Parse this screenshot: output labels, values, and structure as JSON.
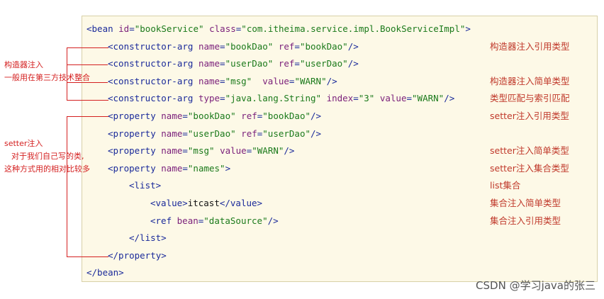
{
  "code_lines": [
    {
      "indent": 0,
      "parts": [
        [
          "tag",
          "<bean "
        ],
        [
          "attr",
          "id"
        ],
        [
          "tag",
          "="
        ],
        [
          "val",
          "\"bookService\""
        ],
        [
          "tag",
          " "
        ],
        [
          "attr",
          "class"
        ],
        [
          "tag",
          "="
        ],
        [
          "val",
          "\"com.itheima.service.impl.BookServiceImpl\""
        ],
        [
          "tag",
          ">"
        ]
      ]
    },
    {
      "indent": 1,
      "parts": [
        [
          "tag",
          "<constructor-arg "
        ],
        [
          "attr",
          "name"
        ],
        [
          "tag",
          "="
        ],
        [
          "val",
          "\"bookDao\""
        ],
        [
          "tag",
          " "
        ],
        [
          "attr",
          "ref"
        ],
        [
          "tag",
          "="
        ],
        [
          "val",
          "\"bookDao\""
        ],
        [
          "tag",
          "/>"
        ]
      ]
    },
    {
      "indent": 1,
      "parts": [
        [
          "tag",
          "<constructor-arg "
        ],
        [
          "attr",
          "name"
        ],
        [
          "tag",
          "="
        ],
        [
          "val",
          "\"userDao\""
        ],
        [
          "tag",
          " "
        ],
        [
          "attr",
          "ref"
        ],
        [
          "tag",
          "="
        ],
        [
          "val",
          "\"userDao\""
        ],
        [
          "tag",
          "/>"
        ]
      ]
    },
    {
      "indent": 1,
      "parts": [
        [
          "tag",
          "<constructor-arg "
        ],
        [
          "attr",
          "name"
        ],
        [
          "tag",
          "="
        ],
        [
          "val",
          "\"msg\""
        ],
        [
          "tag",
          "  "
        ],
        [
          "attr",
          "value"
        ],
        [
          "tag",
          "="
        ],
        [
          "val",
          "\"WARN\""
        ],
        [
          "tag",
          "/>"
        ]
      ]
    },
    {
      "indent": 1,
      "parts": [
        [
          "tag",
          "<constructor-arg "
        ],
        [
          "attr",
          "type"
        ],
        [
          "tag",
          "="
        ],
        [
          "val",
          "\"java.lang.String\""
        ],
        [
          "tag",
          " "
        ],
        [
          "attr",
          "index"
        ],
        [
          "tag",
          "="
        ],
        [
          "val",
          "\"3\""
        ],
        [
          "tag",
          " "
        ],
        [
          "attr",
          "value"
        ],
        [
          "tag",
          "="
        ],
        [
          "val",
          "\"WARN\""
        ],
        [
          "tag",
          "/>"
        ]
      ]
    },
    {
      "indent": 1,
      "parts": [
        [
          "tag",
          "<property "
        ],
        [
          "attr",
          "name"
        ],
        [
          "tag",
          "="
        ],
        [
          "val",
          "\"bookDao\""
        ],
        [
          "tag",
          " "
        ],
        [
          "attr",
          "ref"
        ],
        [
          "tag",
          "="
        ],
        [
          "val",
          "\"bookDao\""
        ],
        [
          "tag",
          "/>"
        ]
      ]
    },
    {
      "indent": 1,
      "parts": [
        [
          "tag",
          "<property "
        ],
        [
          "attr",
          "name"
        ],
        [
          "tag",
          "="
        ],
        [
          "val",
          "\"userDao\""
        ],
        [
          "tag",
          " "
        ],
        [
          "attr",
          "ref"
        ],
        [
          "tag",
          "="
        ],
        [
          "val",
          "\"userDao\""
        ],
        [
          "tag",
          "/>"
        ]
      ]
    },
    {
      "indent": 1,
      "parts": [
        [
          "tag",
          "<property "
        ],
        [
          "attr",
          "name"
        ],
        [
          "tag",
          "="
        ],
        [
          "val",
          "\"msg\""
        ],
        [
          "tag",
          " "
        ],
        [
          "attr",
          "value"
        ],
        [
          "tag",
          "="
        ],
        [
          "val",
          "\"WARN\""
        ],
        [
          "tag",
          "/>"
        ]
      ]
    },
    {
      "indent": 1,
      "parts": [
        [
          "tag",
          "<property "
        ],
        [
          "attr",
          "name"
        ],
        [
          "tag",
          "="
        ],
        [
          "val",
          "\"names\""
        ],
        [
          "tag",
          ">"
        ]
      ]
    },
    {
      "indent": 2,
      "parts": [
        [
          "tag",
          "<list>"
        ]
      ]
    },
    {
      "indent": 3,
      "parts": [
        [
          "tag",
          "<value>"
        ],
        [
          "txt",
          "itcast"
        ],
        [
          "tag",
          "</value>"
        ]
      ]
    },
    {
      "indent": 3,
      "parts": [
        [
          "tag",
          "<ref "
        ],
        [
          "attr",
          "bean"
        ],
        [
          "tag",
          "="
        ],
        [
          "val",
          "\"dataSource\""
        ],
        [
          "tag",
          "/>"
        ]
      ]
    },
    {
      "indent": 2,
      "parts": [
        [
          "tag",
          "</list>"
        ]
      ]
    },
    {
      "indent": 1,
      "parts": [
        [
          "tag",
          "</property>"
        ]
      ]
    },
    {
      "indent": 0,
      "parts": [
        [
          "tag",
          "</bean>"
        ]
      ]
    }
  ],
  "notes": [
    {
      "line": 1,
      "text": "构造器注入引用类型"
    },
    {
      "line": 3,
      "text": "构造器注入简单类型"
    },
    {
      "line": 4,
      "text": "类型匹配与索引匹配"
    },
    {
      "line": 5,
      "text": "setter注入引用类型"
    },
    {
      "line": 7,
      "text": "setter注入简单类型"
    },
    {
      "line": 8,
      "text": "setter注入集合类型"
    },
    {
      "line": 9,
      "text": "list集合"
    },
    {
      "line": 10,
      "text": "集合注入简单类型"
    },
    {
      "line": 11,
      "text": "集合注入引用类型"
    }
  ],
  "side_notes": {
    "constructor": {
      "title": "构造器注入",
      "desc": "一般用在第三方技术整合"
    },
    "setter": {
      "title": "setter注入",
      "desc1": "对于我们自己写的类,",
      "desc2": "这种方式用的相对比较多"
    }
  },
  "watermark": "CSDN @学习java的张三",
  "colors": {
    "tag": "#1a2a9a",
    "attr": "#7a1f7a",
    "value": "#1b7a1b",
    "note": "#c0392b",
    "annotation": "#d42020"
  }
}
